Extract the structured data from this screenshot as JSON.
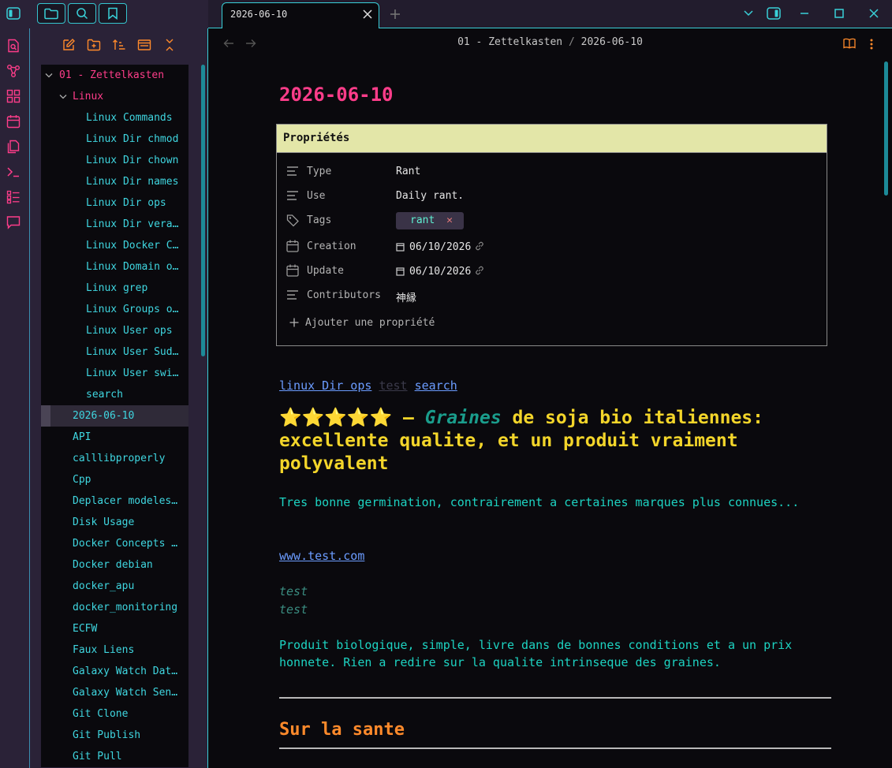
{
  "tab": {
    "title": "2026-06-10"
  },
  "breadcrumb": {
    "folder": "01 - Zettelkasten",
    "separator": "/",
    "note": "2026-06-10"
  },
  "colors": {
    "accent": "#39d0d8",
    "title": "#ff3d8a",
    "heading": "#f3d52a",
    "paragraph": "#1dd3c2",
    "link": "#6b9cff",
    "section": "#ff8a2b",
    "props_header": "#e3e6a8"
  },
  "explorer": {
    "folder_root": "01 - Zettelkasten",
    "folder_linux": "Linux",
    "linux_items": [
      "Linux Commands",
      "Linux Dir chmod",
      "Linux Dir chown",
      "Linux Dir names",
      "Linux Dir ops",
      "Linux Dir vera…",
      "Linux Docker C…",
      "Linux Domain o…",
      "Linux grep",
      "Linux Groups o…",
      "Linux User ops",
      "Linux User Sud…",
      "Linux User swi…",
      "search"
    ],
    "root_items": [
      "2026-06-10",
      "API",
      "calllibproperly",
      "Cpp",
      "Deplacer modeles…",
      "Disk Usage",
      "Docker Concepts …",
      "Docker debian",
      "docker_apu",
      "docker_monitoring",
      "ECFW",
      "Faux Liens",
      "Galaxy Watch Dat…",
      "Galaxy Watch Sen…",
      "Git Clone",
      "Git Publish",
      "Git Pull"
    ],
    "active_item": "2026-06-10"
  },
  "note": {
    "title": "2026-06-10",
    "properties": {
      "header": "Propriétés",
      "type_key": "Type",
      "type_val": "Rant",
      "use_key": "Use",
      "use_val": "Daily rant.",
      "tags_key": "Tags",
      "tag": "rant",
      "creation_key": "Creation",
      "creation_val": "06/10/2026",
      "update_key": "Update",
      "update_val": "06/10/2026",
      "contributors_key": "Contributors",
      "contributors_val": "神縁",
      "add_label": "Ajouter une propriété"
    },
    "links": {
      "link1": "linux Dir ops",
      "link2": "test",
      "link3": "search"
    },
    "review_heading_stars": "⭐⭐⭐⭐⭐ — ",
    "review_heading_em": "Graines",
    "review_heading_rest": " de soja bio italiennes: excellente qualite, et un produit vraiment polyvalent",
    "paragraph1": "Tres bonne germination, contrairement a certaines marques plus connues...",
    "url": "www.test.com",
    "italic1": "test",
    "italic2": "test",
    "paragraph2": "Produit biologique, simple, livre dans de bonnes conditions et a un prix honnete. Rien a redire sur la qualite intrinseque des graines.",
    "section_heading": "Sur la sante"
  }
}
